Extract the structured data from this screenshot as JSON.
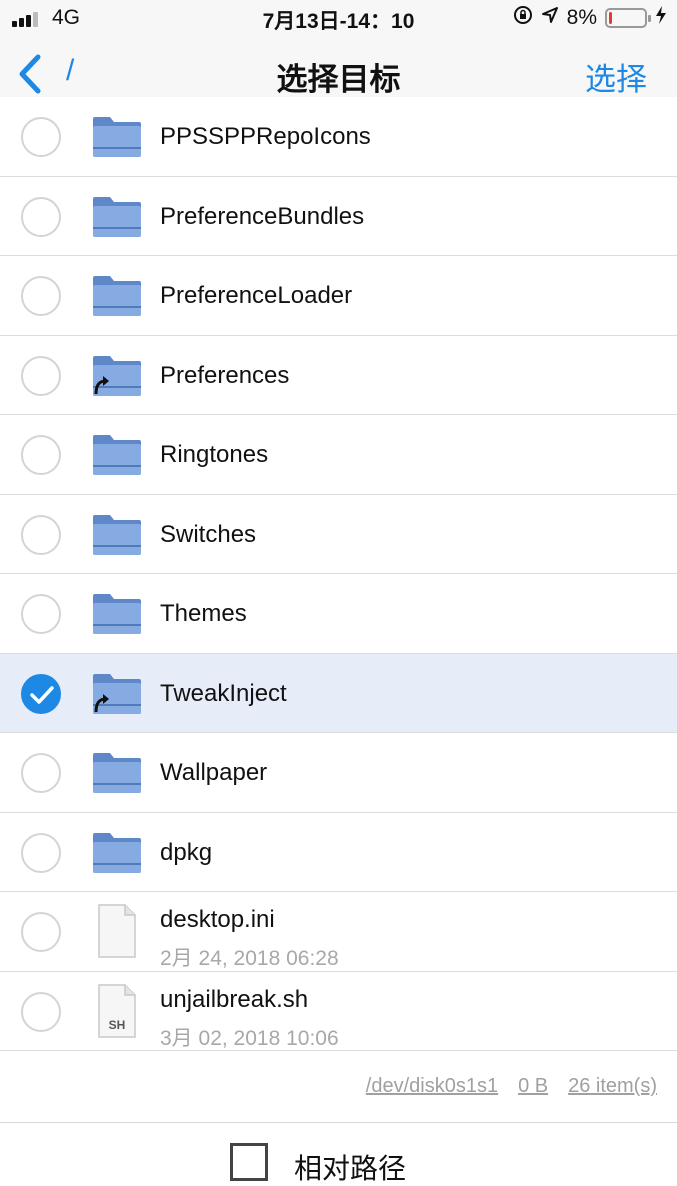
{
  "status": {
    "carrier": "4G",
    "time": "7月13日-14：10",
    "battery_pct": "8%",
    "battery_level": 0.08
  },
  "nav": {
    "path": "/",
    "title": "选择目标",
    "select_label": "选择"
  },
  "items": [
    {
      "name": "PPSSPPRepoIcons",
      "type": "folder",
      "selected": false
    },
    {
      "name": "PreferenceBundles",
      "type": "folder",
      "selected": false
    },
    {
      "name": "PreferenceLoader",
      "type": "folder",
      "selected": false
    },
    {
      "name": "Preferences",
      "type": "folder-link",
      "selected": false
    },
    {
      "name": "Ringtones",
      "type": "folder",
      "selected": false
    },
    {
      "name": "Switches",
      "type": "folder",
      "selected": false
    },
    {
      "name": "Themes",
      "type": "folder",
      "selected": false
    },
    {
      "name": "TweakInject",
      "type": "folder-link",
      "selected": true
    },
    {
      "name": "Wallpaper",
      "type": "folder",
      "selected": false
    },
    {
      "name": "dpkg",
      "type": "folder",
      "selected": false
    },
    {
      "name": "desktop.ini",
      "type": "file",
      "date": "2月 24, 2018 06:28",
      "badge": "",
      "selected": false
    },
    {
      "name": "unjailbreak.sh",
      "type": "file",
      "date": "3月 02, 2018 10:06",
      "badge": "SH",
      "selected": false
    }
  ],
  "footer": {
    "disk": "/dev/disk0s1s1",
    "size": "0 B",
    "count": "26 item(s)"
  },
  "bottom": {
    "relative_path_label": "相对路径"
  },
  "colors": {
    "accent": "#1e88e5",
    "selected_row": "#e7edf8",
    "folder": "#6f98d6"
  }
}
